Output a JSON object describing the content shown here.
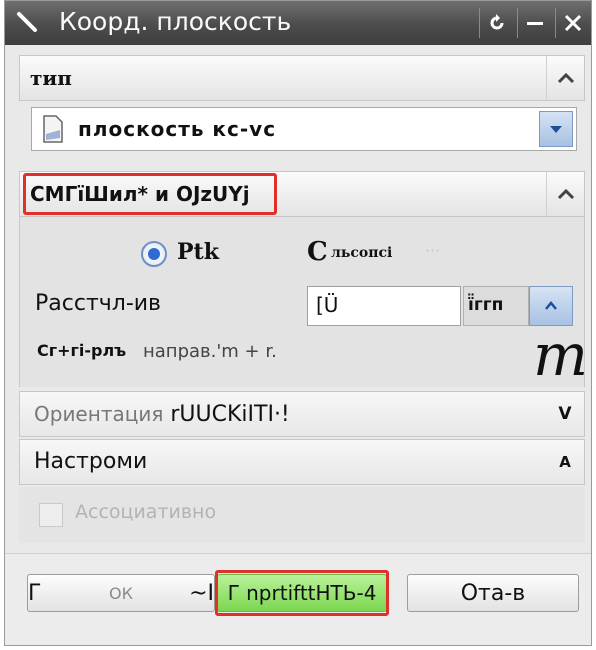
{
  "window": {
    "title": "Коорд. плоскость",
    "buttons": {
      "reset": "reset",
      "minimize": "minimize",
      "close": "close"
    }
  },
  "type_section": {
    "header": "тип",
    "selected_value": "плоскость кс-vc",
    "icon": "plane-doc-icon"
  },
  "offset_section": {
    "header": "СМГїШил* и OJzUYj",
    "radio_point": "Ptk",
    "radio_other": "льсопсі",
    "radio_other_prefix": "C",
    "radio_other_suffix": "···",
    "distance_label": "Расстчл-ив",
    "distance_value": "[Ü",
    "distance_unit": "ї̈ггп",
    "direction_label_bold": "Сг+гі-рлъ",
    "direction_label": "направ.'m + r.",
    "big_m": "m"
  },
  "orientation_row": {
    "label_gray": "Ориентация",
    "label_rest": "rUUCKiITI·!",
    "toggle": "V"
  },
  "settings_row": {
    "label": "Настроми",
    "toggle": "A"
  },
  "associative": {
    "label": "Ассоциативно"
  },
  "buttons": {
    "ok_prefix": "Г",
    "ok": "ОК",
    "ok_suffix": "~I",
    "apply": "Г nprtifttНТЬ-4",
    "cancel": "Ота-в"
  },
  "colors": {
    "highlight": "#e0302a",
    "apply_green": "#7cd650",
    "radio_blue": "#2f6cd1"
  }
}
